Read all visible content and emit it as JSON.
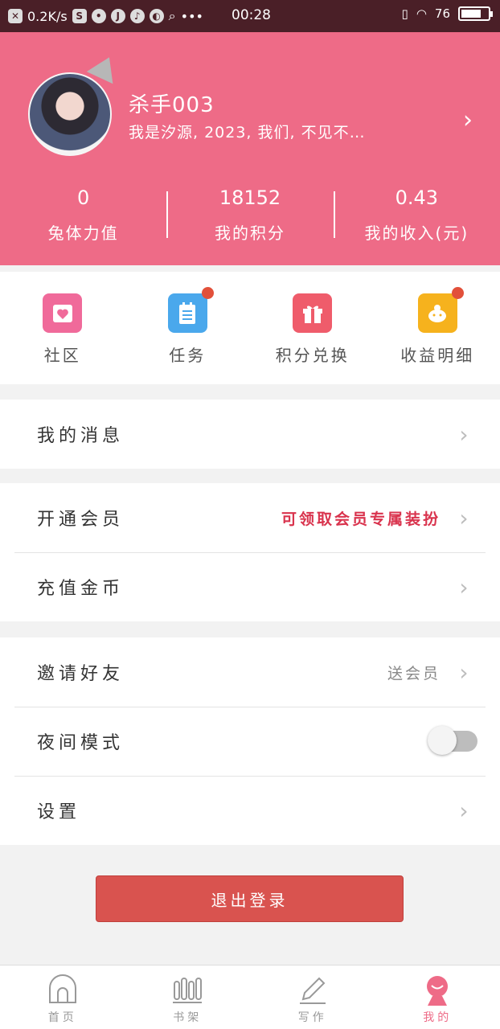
{
  "status_bar": {
    "net_speed": "0.2K/s",
    "time": "00:28",
    "battery": "76",
    "battery_level": 0.76
  },
  "profile": {
    "username": "杀手003",
    "bio": "我是汐源, 2023, 我们, 不见不…",
    "stats": [
      {
        "value": "0",
        "label": "兔体力值"
      },
      {
        "value": "18152",
        "label": "我的积分"
      },
      {
        "value": "0.43",
        "label": "我的收入(元)"
      }
    ]
  },
  "quick_actions": [
    {
      "label": "社区",
      "icon": "community-icon",
      "color": "#f06a9a",
      "badge": false
    },
    {
      "label": "任务",
      "icon": "task-icon",
      "color": "#4aa8ec",
      "badge": true
    },
    {
      "label": "积分兑换",
      "icon": "gift-icon",
      "color": "#ef5c6b",
      "badge": false
    },
    {
      "label": "收益明细",
      "icon": "piggy-bank-icon",
      "color": "#f6b21d",
      "badge": true
    }
  ],
  "menu": {
    "messages": {
      "title": "我的消息"
    },
    "vip": {
      "title": "开通会员",
      "extra": "可领取会员专属装扮"
    },
    "recharge": {
      "title": "充值金币"
    },
    "invite": {
      "title": "邀请好友",
      "extra": "送会员"
    },
    "night_mode": {
      "title": "夜间模式",
      "enabled": false
    },
    "settings": {
      "title": "设置"
    }
  },
  "logout_label": "退出登录",
  "tabs": [
    {
      "label": "首页",
      "icon": "home-icon",
      "active": false
    },
    {
      "label": "书架",
      "icon": "bookshelf-icon",
      "active": false
    },
    {
      "label": "写作",
      "icon": "pen-icon",
      "active": false
    },
    {
      "label": "我的",
      "icon": "profile-icon",
      "active": true
    }
  ],
  "colors": {
    "header": "#ee6b87",
    "status_bar": "#4a1f27",
    "logout": "#d9534f",
    "accent_red": "#d9334d"
  }
}
